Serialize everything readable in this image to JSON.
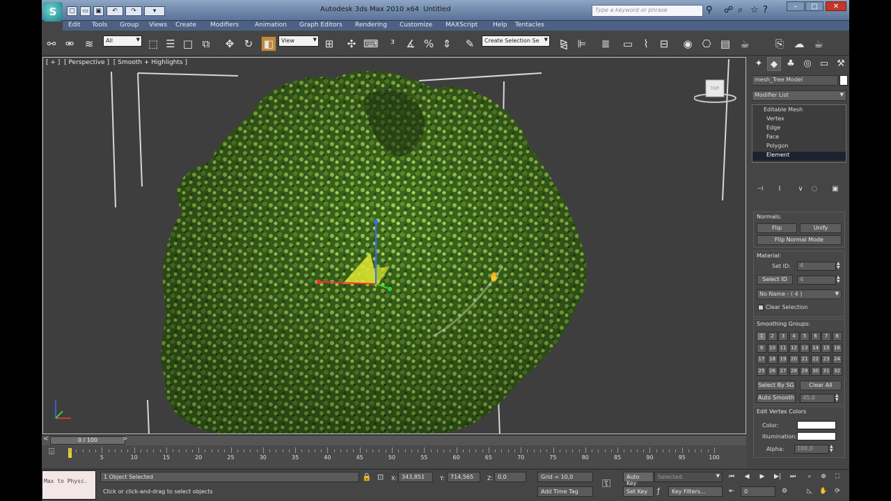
{
  "window": {
    "app_title": "Autodesk 3ds Max 2010 x64",
    "document": "Untitled",
    "search_placeholder": "Type a keyword or phrase",
    "minimize": "–",
    "maximize": "□",
    "close": "✕"
  },
  "menu": [
    "Edit",
    "Tools",
    "Group",
    "Views",
    "Create",
    "Modifiers",
    "Animation",
    "Graph Editors",
    "Rendering",
    "Customize",
    "MAXScript",
    "Help",
    "Tentacles"
  ],
  "toolbar": {
    "selection_filter": "All",
    "reference_coord": "View",
    "named_selection": "Create Selection Se"
  },
  "viewport": {
    "label_plus": "[ + ]",
    "label_view": "[ Perspective ]",
    "label_shading": "[ Smooth + Highlights ]",
    "viewcube_face": "TOP"
  },
  "command_panel": {
    "object_name": "mesh_Tree Model",
    "modifier_list": "Modifier List",
    "stack": [
      {
        "label": "Editable Mesh",
        "parent": true
      },
      {
        "label": "Vertex"
      },
      {
        "label": "Edge"
      },
      {
        "label": "Face"
      },
      {
        "label": "Polygon"
      },
      {
        "label": "Element",
        "selected": true
      }
    ],
    "normals": {
      "title": "Normals:",
      "flip": "Flip",
      "unify": "Unify",
      "flip_normal_mode": "Flip Normal Mode"
    },
    "material": {
      "title": "Material:",
      "set_id_label": "Set ID:",
      "set_id_value": "4",
      "select_id": "Select ID",
      "select_id_value": "4",
      "name_dropdown": "No Name - ( 4 )",
      "clear_selection": "Clear Selection"
    },
    "smoothing": {
      "title": "Smoothing Groups:",
      "groups": [
        "1",
        "2",
        "3",
        "4",
        "5",
        "6",
        "7",
        "8",
        "9",
        "10",
        "11",
        "12",
        "13",
        "14",
        "15",
        "16",
        "17",
        "18",
        "19",
        "20",
        "21",
        "22",
        "23",
        "24",
        "25",
        "26",
        "27",
        "28",
        "29",
        "30",
        "31",
        "32"
      ],
      "select_by_sg": "Select By SG",
      "clear_all": "Clear All",
      "auto_smooth": "Auto Smooth",
      "auto_smooth_value": "45,0"
    },
    "vertex_colors": {
      "title": "Edit Vertex Colors",
      "color": "Color:",
      "illumination": "Illumination:",
      "alpha": "Alpha:",
      "alpha_value": "100,0"
    }
  },
  "timeline": {
    "frame": "0 / 100",
    "prev": "<",
    "next": ">",
    "ticks": [
      "5",
      "10",
      "15",
      "20",
      "25",
      "30",
      "35",
      "40",
      "45",
      "50",
      "55",
      "60",
      "65",
      "70",
      "75",
      "80",
      "85",
      "90",
      "95",
      "100"
    ]
  },
  "status": {
    "maxscript": "Max to Physc.",
    "selected": "1 Object Selected",
    "prompt": "Click or click-and-drag to select objects",
    "x_label": "X:",
    "x_value": "343,851",
    "y_label": "Y:",
    "y_value": "714,565",
    "z_label": "Z:",
    "z_value": "0,0",
    "grid": "Grid = 10,0",
    "add_time_tag": "Add Time Tag",
    "auto_key": "Auto Key",
    "set_key": "Set Key",
    "key_mode": "Selected",
    "key_filters": "Key Filters...",
    "current_frame": "0"
  }
}
